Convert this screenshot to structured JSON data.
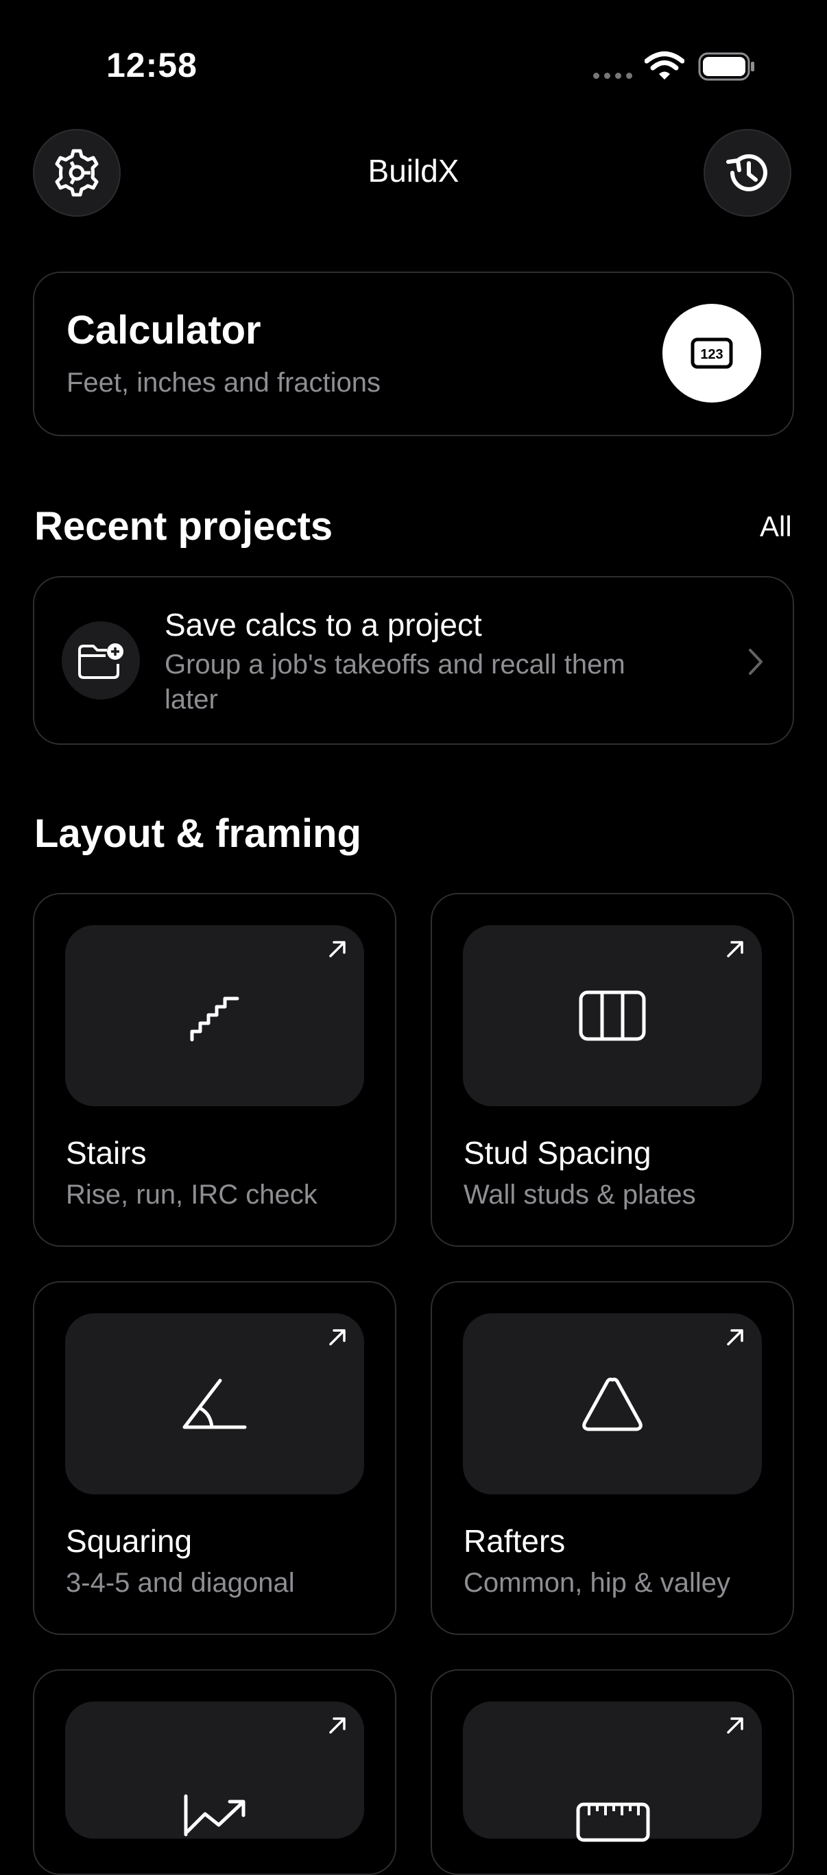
{
  "status_bar": {
    "time": "12:58"
  },
  "header": {
    "title": "BuildX",
    "settings_icon": "gear-icon",
    "history_icon": "history-icon"
  },
  "calculator": {
    "title": "Calculator",
    "subtitle": "Feet, inches and fractions",
    "icon": "numeric-keypad-icon",
    "icon_text": "123"
  },
  "recent_projects": {
    "title": "Recent projects",
    "all_label": "All",
    "prompt": {
      "title": "Save calcs to a project",
      "description": "Group a job's takeoffs and recall them later",
      "icon": "folder-add-icon"
    }
  },
  "layout_framing": {
    "title": "Layout & framing",
    "tools": [
      {
        "title": "Stairs",
        "subtitle": "Rise, run, IRC check",
        "icon": "stairs-icon"
      },
      {
        "title": "Stud Spacing",
        "subtitle": "Wall studs & plates",
        "icon": "studs-icon"
      },
      {
        "title": "Squaring",
        "subtitle": "3-4-5 and diagonal",
        "icon": "angle-icon"
      },
      {
        "title": "Rafters",
        "subtitle": "Common, hip & valley",
        "icon": "triangle-icon"
      },
      {
        "title": "",
        "subtitle": "",
        "icon": "trend-chart-icon"
      },
      {
        "title": "",
        "subtitle": "",
        "icon": "ruler-icon"
      }
    ]
  },
  "colors": {
    "background": "#000000",
    "card_surface": "#1c1c1e",
    "card_border": "#2e2e30",
    "secondary_text": "#8e8e93"
  }
}
